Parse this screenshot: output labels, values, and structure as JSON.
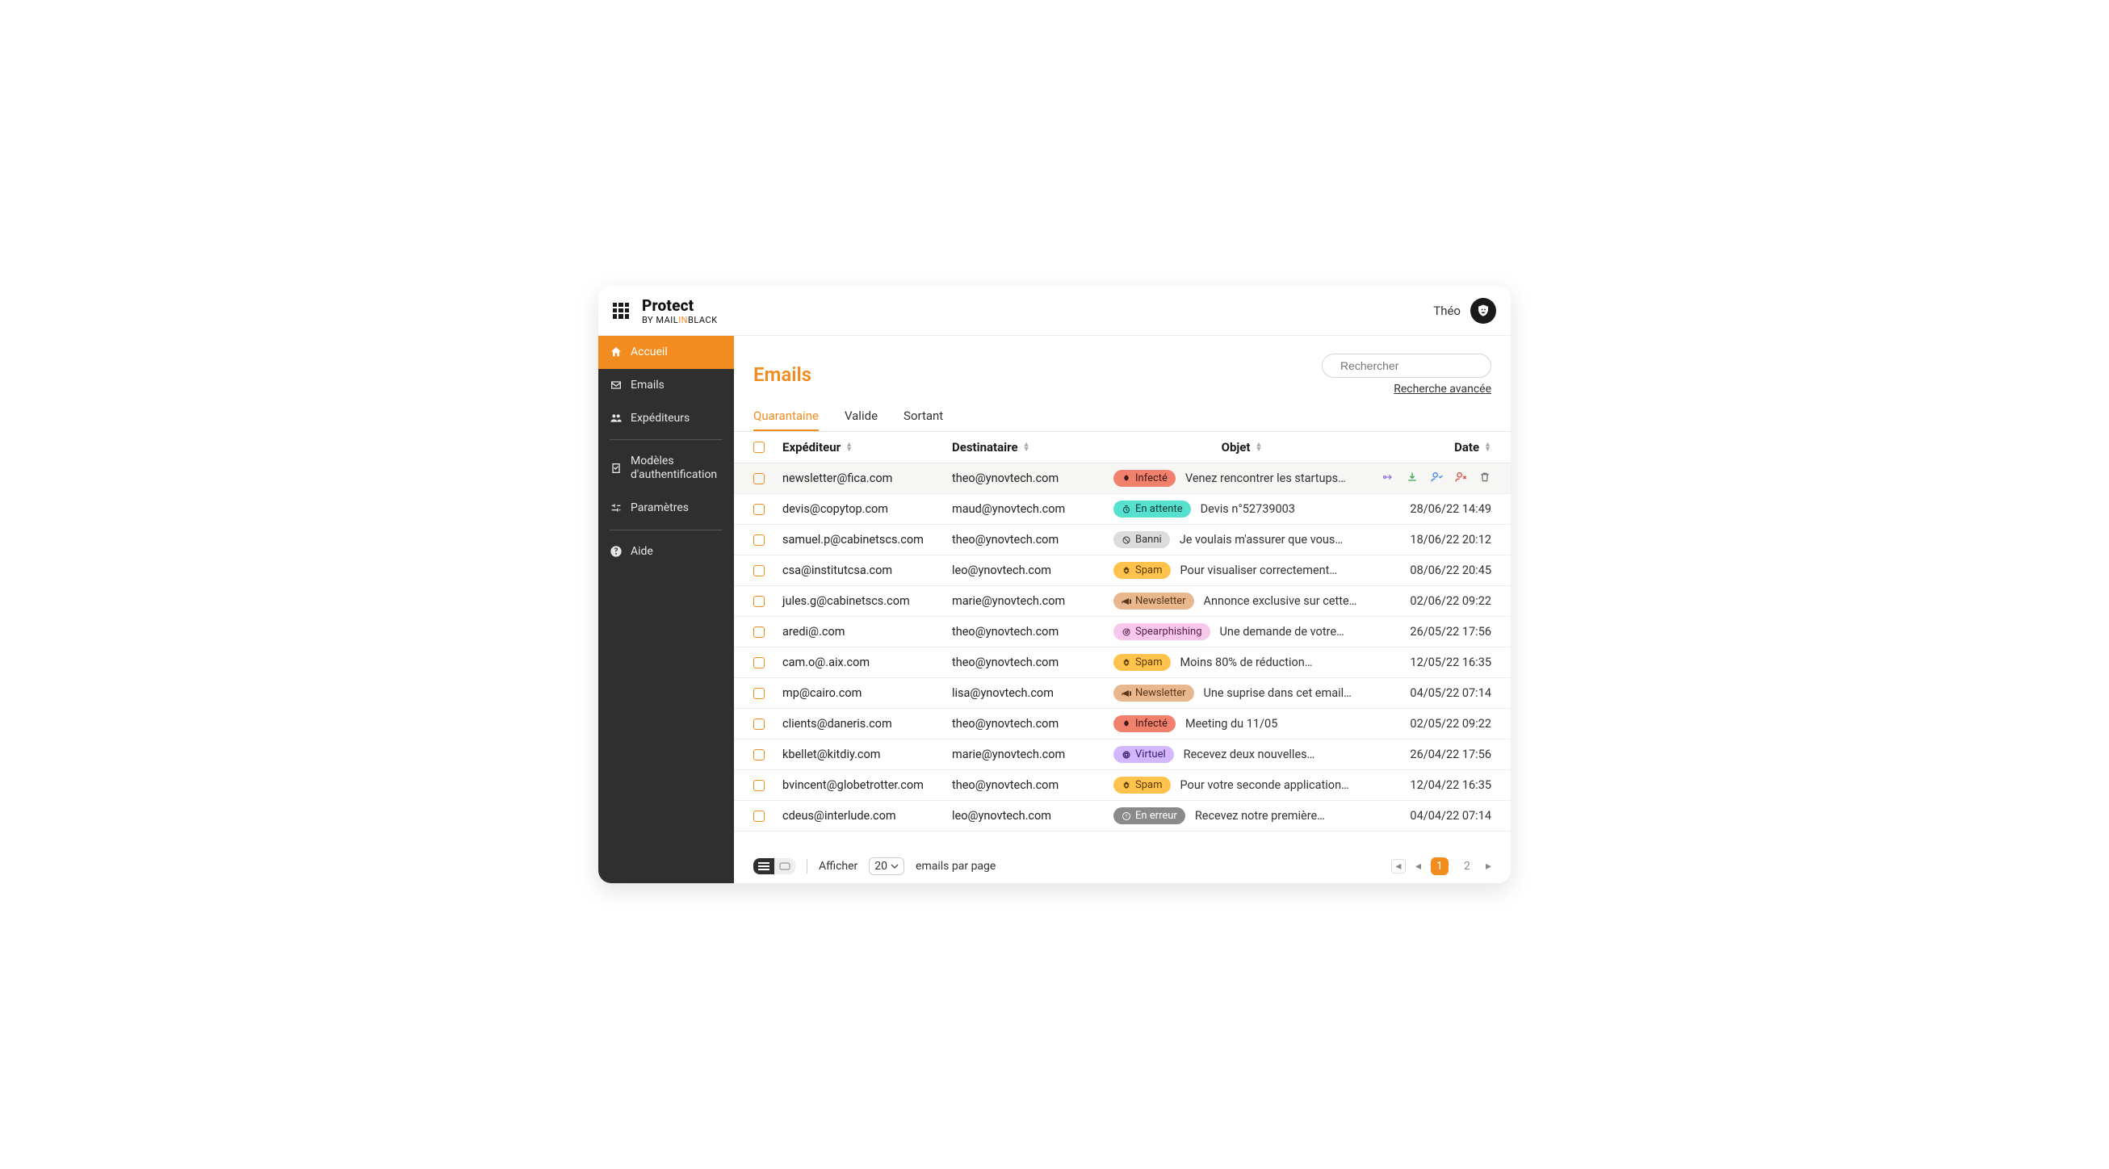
{
  "brand": {
    "title": "Protect",
    "by": "BY MAIL",
    "in": "IN",
    "black": "BLACK"
  },
  "user": {
    "name": "Théo"
  },
  "sidebar": {
    "items": [
      {
        "label": "Accueil"
      },
      {
        "label": "Emails"
      },
      {
        "label": "Expéditeurs"
      },
      {
        "label": "Modèles d'authentification"
      },
      {
        "label": "Paramètres"
      },
      {
        "label": "Aide"
      }
    ]
  },
  "page": {
    "title": "Emails"
  },
  "search": {
    "placeholder": "Rechercher",
    "advanced": "Recherche avancée"
  },
  "tabs": [
    "Quarantaine",
    "Valide",
    "Sortant"
  ],
  "table": {
    "columns": {
      "sender": "Expéditeur",
      "recipient": "Destinataire",
      "subject": "Objet",
      "date": "Date"
    },
    "rows": [
      {
        "sender": "newsletter@fica.com",
        "recipient": "theo@ynovtech.com",
        "tag": "infecte",
        "tag_label": "Infecté",
        "subject": "Venez rencontrer les startups…",
        "date": "",
        "hover": true
      },
      {
        "sender": "devis@copytop.com",
        "recipient": "maud@ynovtech.com",
        "tag": "attente",
        "tag_label": "En attente",
        "subject": "Devis n°52739003",
        "date": "28/06/22 14:49"
      },
      {
        "sender": "samuel.p@cabinetscs.com",
        "recipient": "theo@ynovtech.com",
        "tag": "banni",
        "tag_label": "Banni",
        "subject": "Je  voulais m'assurer que vous…",
        "date": "18/06/22 20:12"
      },
      {
        "sender": "csa@institutcsa.com",
        "recipient": "leo@ynovtech.com",
        "tag": "spam",
        "tag_label": "Spam",
        "subject": "Pour visualiser correctement…",
        "date": "08/06/22 20:45"
      },
      {
        "sender": "jules.g@cabinetscs.com",
        "recipient": "marie@ynovtech.com",
        "tag": "newsletter",
        "tag_label": "Newsletter",
        "subject": "Annonce exclusive sur cette…",
        "date": "02/06/22 09:22"
      },
      {
        "sender": "aredi@.com",
        "recipient": "theo@ynovtech.com",
        "tag": "spear",
        "tag_label": "Spearphishing",
        "subject": "Une demande de votre…",
        "date": "26/05/22 17:56"
      },
      {
        "sender": "cam.o@.aix.com",
        "recipient": "theo@ynovtech.com",
        "tag": "spam",
        "tag_label": "Spam",
        "subject": "Moins 80% de réduction…",
        "date": "12/05/22 16:35"
      },
      {
        "sender": "mp@cairo.com",
        "recipient": "lisa@ynovtech.com",
        "tag": "newsletter",
        "tag_label": "Newsletter",
        "subject": "Une suprise dans cet email…",
        "date": "04/05/22 07:14"
      },
      {
        "sender": "clients@daneris.com",
        "recipient": "theo@ynovtech.com",
        "tag": "infecte",
        "tag_label": "Infecté",
        "subject": "Meeting du 11/05",
        "date": "02/05/22 09:22"
      },
      {
        "sender": "kbellet@kitdiy.com",
        "recipient": "marie@ynovtech.com",
        "tag": "virtuel",
        "tag_label": "Virtuel",
        "subject": "Recevez deux nouvelles…",
        "date": "26/04/22 17:56"
      },
      {
        "sender": "bvincent@globetrotter.com",
        "recipient": "theo@ynovtech.com",
        "tag": "spam",
        "tag_label": "Spam",
        "subject": "Pour votre seconde application…",
        "date": "12/04/22 16:35"
      },
      {
        "sender": "cdeus@interlude.com",
        "recipient": "leo@ynovtech.com",
        "tag": "erreur",
        "tag_label": "En erreur",
        "subject": "Recevez notre première…",
        "date": "04/04/22 07:14"
      }
    ]
  },
  "footer": {
    "show_label": "Afficher",
    "per_page_value": "20",
    "per_page_suffix": "emails par page",
    "pages": [
      "1",
      "2"
    ]
  }
}
